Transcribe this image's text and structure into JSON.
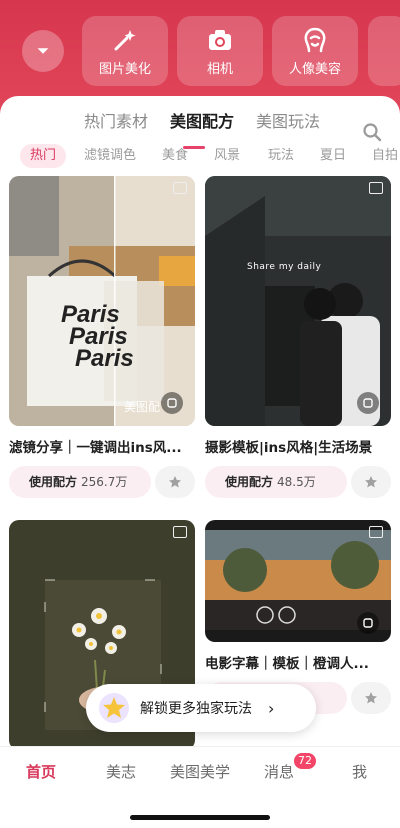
{
  "tools": [
    {
      "label": "图片美化",
      "icon": "magic-wand-icon"
    },
    {
      "label": "相机",
      "icon": "camera-icon"
    },
    {
      "label": "人像美容",
      "icon": "face-icon"
    }
  ],
  "main_tabs": [
    "热门素材",
    "美图配方",
    "美图玩法"
  ],
  "active_main_tab": "美图配方",
  "sub_tabs": [
    "热门",
    "滤镜调色",
    "美食",
    "风景",
    "玩法",
    "夏日",
    "自拍"
  ],
  "active_sub_tab": "热门",
  "cards": [
    {
      "title": "滤镜分享｜一键调出ins风...",
      "use_label": "使用配方",
      "use_count": "256.7万",
      "overlay_text": "Paris",
      "watermark": "美图配"
    },
    {
      "title": "摄影模板|ins风格|生活场景",
      "use_label": "使用配方",
      "use_count": "48.5万",
      "overlay_text": "Share my daily"
    },
    {
      "title": "",
      "use_label": "",
      "use_count": ""
    },
    {
      "title": "电影字幕｜模板｜橙调人...",
      "use_label": "",
      "use_count": ""
    }
  ],
  "unlock_text": "解锁更多独家玩法",
  "unlock_arrow": "›",
  "nav": [
    "首页",
    "美志",
    "美图美学",
    "消息",
    "我"
  ],
  "active_nav": "首页",
  "message_badge": "72",
  "colors": {
    "brand_red": "#d6364e",
    "accent_pink": "#e6426a"
  }
}
